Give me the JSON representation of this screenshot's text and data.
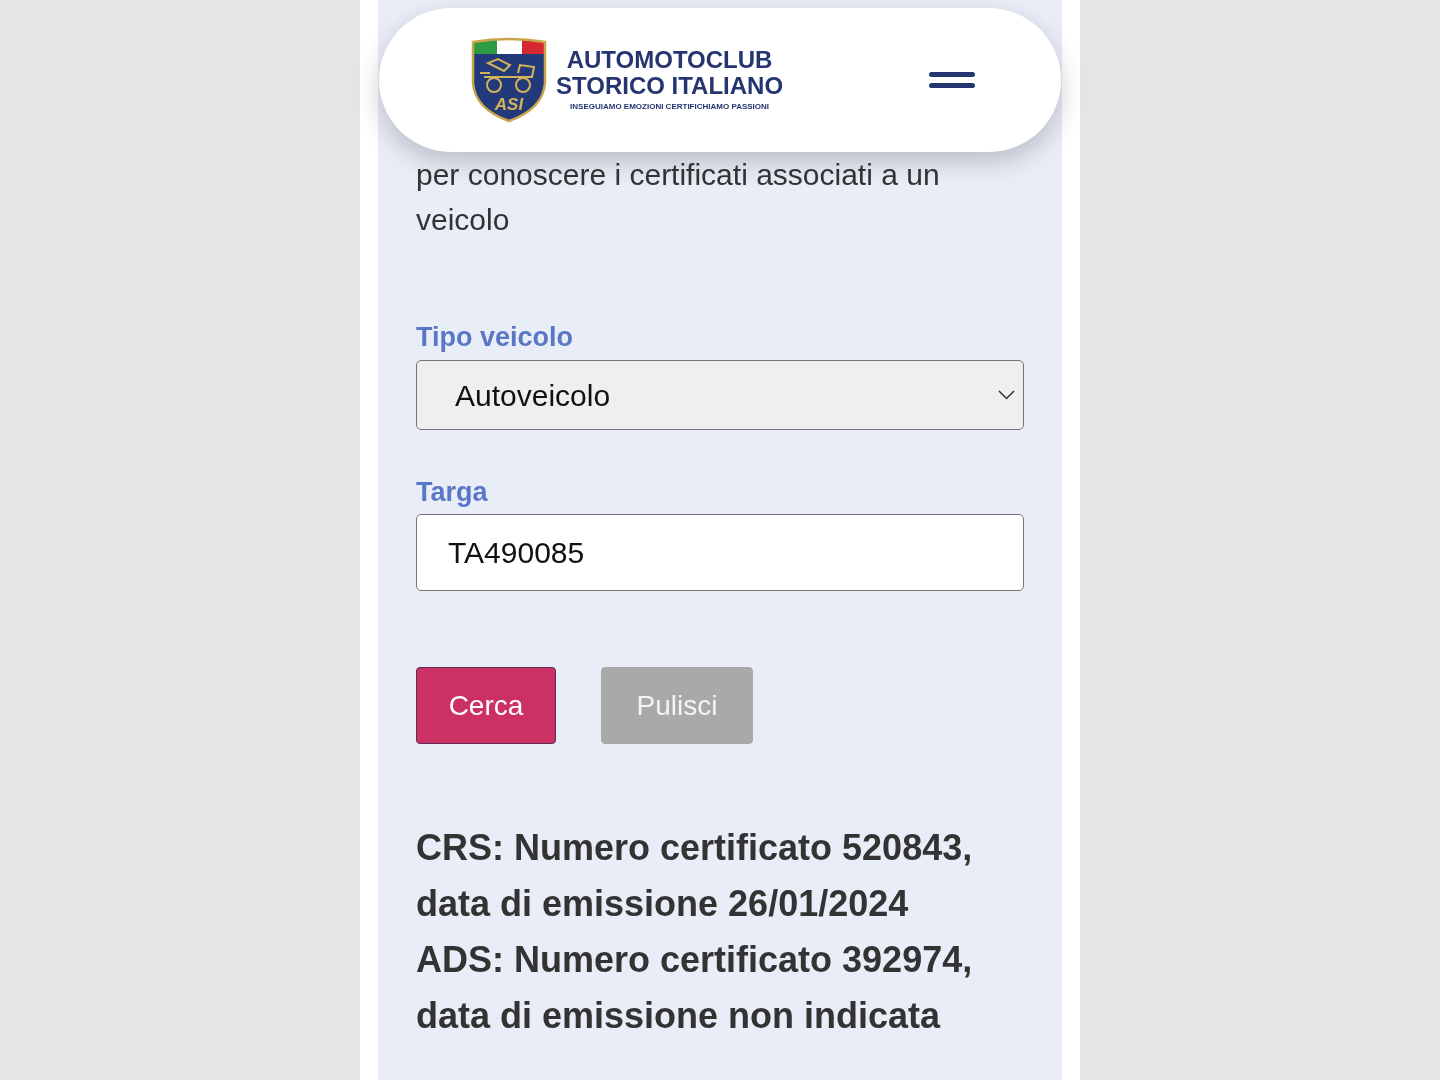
{
  "header": {
    "logo": {
      "emblem_text": "ASI",
      "title_line_1": "AUTOMOTOCLUB",
      "title_line_2": "STORICO ITALIANO",
      "tagline": "INSEGUIAMO EMOZIONI CERTIFICHIAMO PASSIONI"
    }
  },
  "intro": "per conoscere i certificati associati a un veicolo",
  "form": {
    "fields": [
      {
        "kind": "select",
        "label": "Tipo veicolo",
        "value": "Autoveicolo"
      },
      {
        "kind": "text",
        "label": "Targa",
        "value": "TA490085"
      }
    ]
  },
  "buttons": [
    {
      "kind": "primary",
      "label": "Cerca"
    },
    {
      "kind": "secondary",
      "label": "Pulisci"
    }
  ],
  "results": [
    "CRS: Numero certificato 520843, data di emissione 26/01/2024",
    "ADS: Numero certificato 392974, data di emissione non indicata"
  ]
}
